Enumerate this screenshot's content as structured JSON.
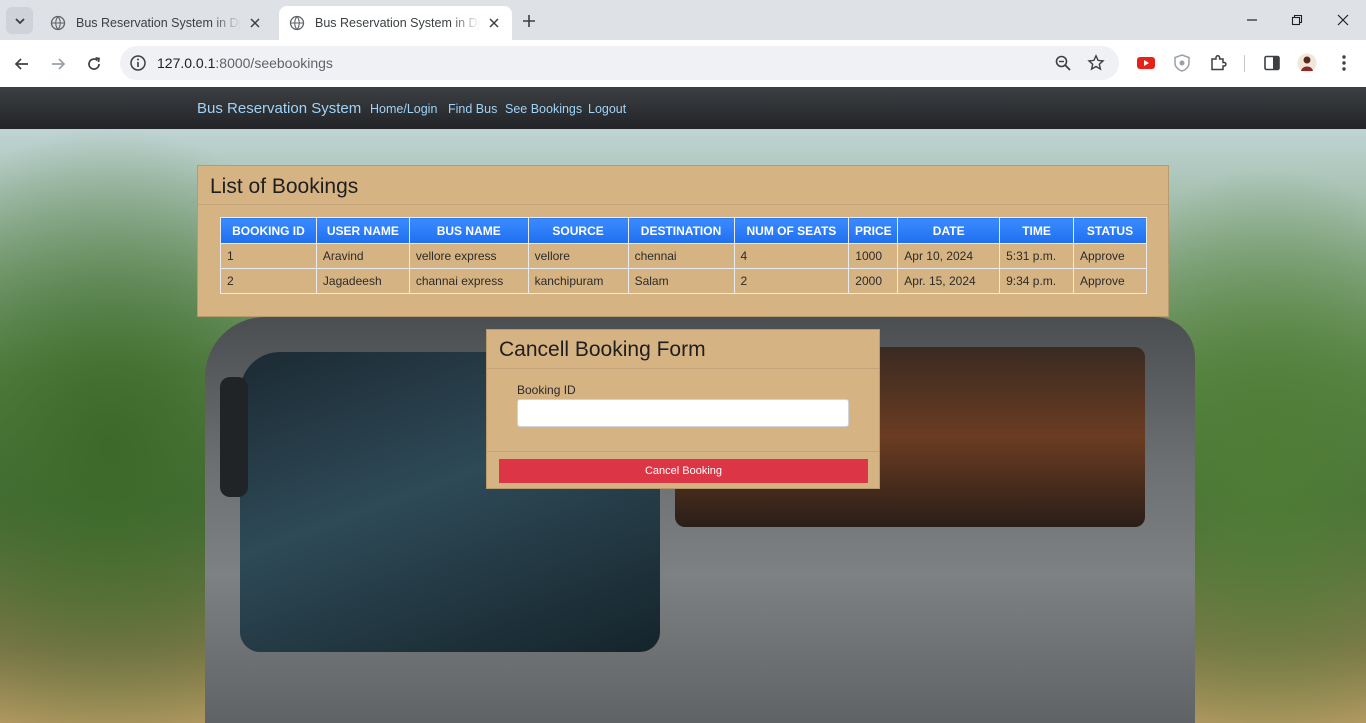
{
  "browser": {
    "tabs": [
      {
        "title": "Bus Reservation System in Django",
        "active": false
      },
      {
        "title": "Bus Reservation System in Django",
        "active": true
      }
    ],
    "url_host": "127.0.0.1",
    "url_path": ":8000/seebookings"
  },
  "nav": {
    "brand": "Bus Reservation System",
    "links": [
      "Home/Login",
      "Find Bus",
      "See Bookings",
      "Logout"
    ]
  },
  "bookings": {
    "title": "List of Bookings",
    "columns": [
      "BOOKING ID",
      "USER NAME",
      "BUS NAME",
      "SOURCE",
      "DESTINATION",
      "NUM OF SEATS",
      "PRICE",
      "DATE",
      "TIME",
      "STATUS"
    ],
    "rows": [
      [
        "1",
        "Aravind",
        "vellore express",
        "vellore",
        "chennai",
        "4",
        "1000",
        "Apr 10, 2024",
        "5:31 p.m.",
        "Approve"
      ],
      [
        "2",
        "Jagadeesh",
        "channai express",
        "kanchipuram",
        "Salam",
        "2",
        "2000",
        "Apr. 15, 2024",
        "9:34 p.m.",
        "Approve"
      ]
    ]
  },
  "cancel_form": {
    "title": "Cancell Booking Form",
    "field_label": "Booking ID",
    "field_value": "",
    "button_label": "Cancel Booking"
  },
  "colors": {
    "panel": "#d6b383",
    "table_header": "#1f6ff0",
    "cancel_button": "#dc3545",
    "nav_link": "#9fd3f7"
  }
}
